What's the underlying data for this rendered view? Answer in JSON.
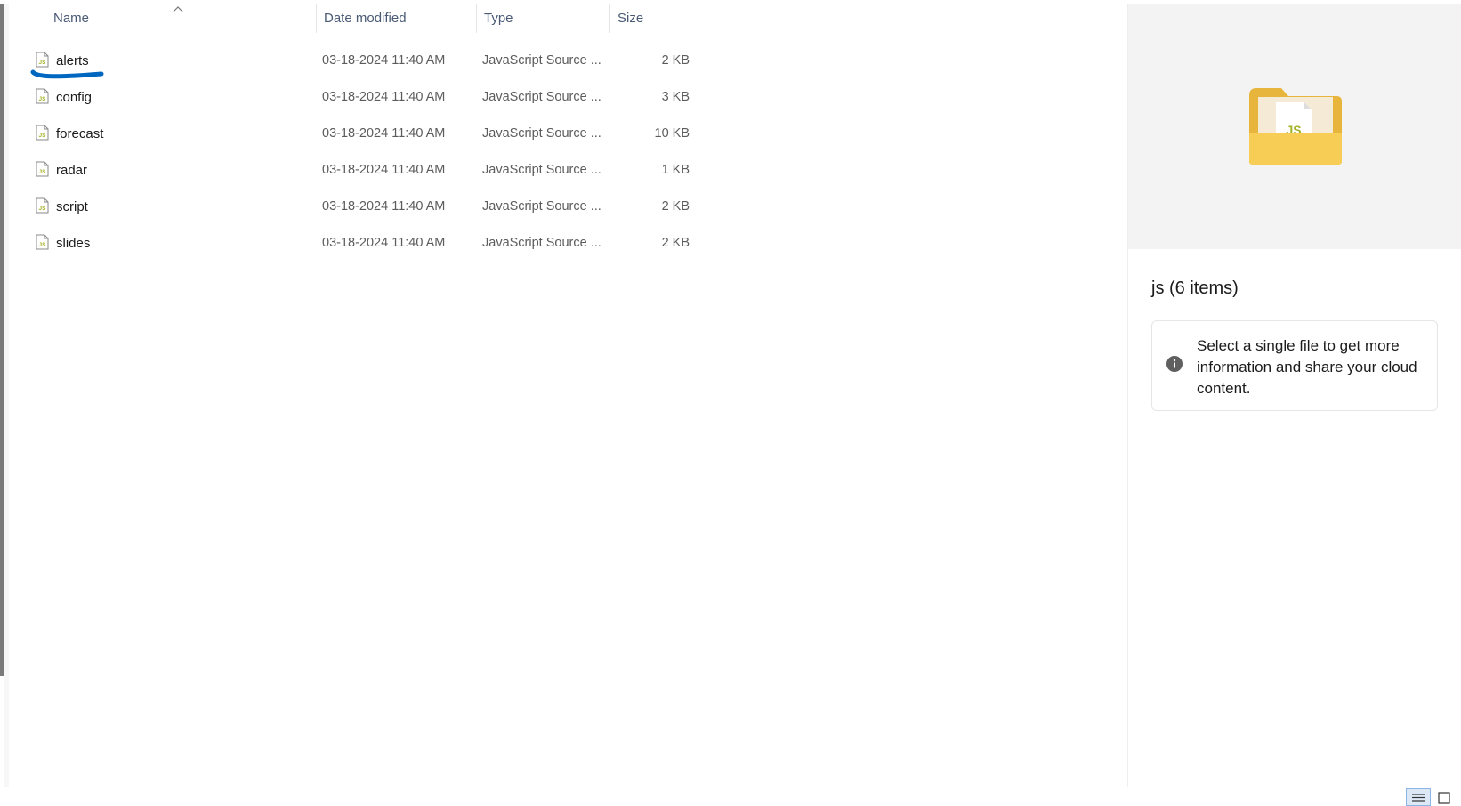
{
  "columns": {
    "name": "Name",
    "date_modified": "Date modified",
    "type": "Type",
    "size": "Size"
  },
  "files": [
    {
      "name": "alerts",
      "date": "03-18-2024 11:40 AM",
      "type": "JavaScript Source ...",
      "size": "2 KB"
    },
    {
      "name": "config",
      "date": "03-18-2024 11:40 AM",
      "type": "JavaScript Source ...",
      "size": "3 KB"
    },
    {
      "name": "forecast",
      "date": "03-18-2024 11:40 AM",
      "type": "JavaScript Source ...",
      "size": "10 KB"
    },
    {
      "name": "radar",
      "date": "03-18-2024 11:40 AM",
      "type": "JavaScript Source ...",
      "size": "1 KB"
    },
    {
      "name": "script",
      "date": "03-18-2024 11:40 AM",
      "type": "JavaScript Source ...",
      "size": "2 KB"
    },
    {
      "name": "slides",
      "date": "03-18-2024 11:40 AM",
      "type": "JavaScript Source ...",
      "size": "2 KB"
    }
  ],
  "details": {
    "title": "js (6 items)",
    "info_message": "Select a single file to get more information and share your cloud content."
  },
  "icons": {
    "file": "js-file-icon",
    "folder": "folder-icon",
    "info": "info-icon",
    "sort": "sort-ascending-icon",
    "details_view": "details-view-icon",
    "tiles_view": "large-icons-view-icon"
  },
  "colors": {
    "header_text": "#4a5a75",
    "annotation": "#0067c0",
    "folder": "#f5c242",
    "js_badge": "#a6b32b"
  }
}
